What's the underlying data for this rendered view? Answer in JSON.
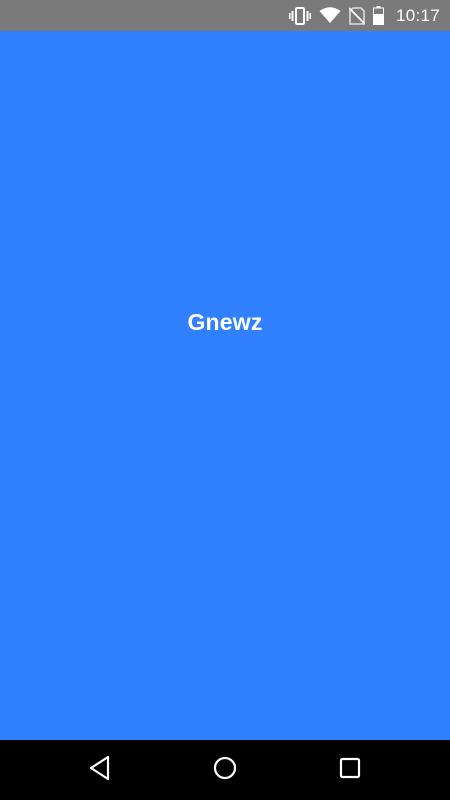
{
  "status_bar": {
    "time": "10:17",
    "icons": [
      "vibrate-icon",
      "wifi-icon",
      "no-sim-icon",
      "battery-icon"
    ],
    "background": "#7a7a7a"
  },
  "splash": {
    "app_name": "Gnewz",
    "background": "#3080ff",
    "text_color": "#ffffff"
  },
  "nav_bar": {
    "buttons": [
      "back-icon",
      "home-icon",
      "recents-icon"
    ],
    "background": "#000000"
  }
}
